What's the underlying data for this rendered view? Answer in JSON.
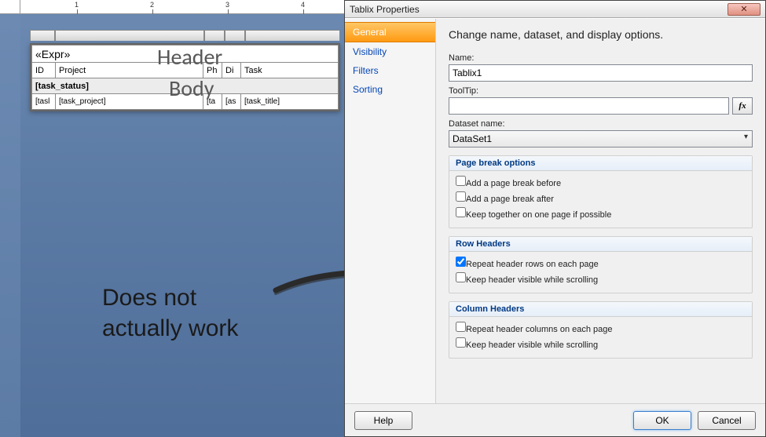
{
  "dialog": {
    "title": "Tablix Properties",
    "heading": "Change name, dataset, and display options.",
    "nav": {
      "general": "General",
      "visibility": "Visibility",
      "filters": "Filters",
      "sorting": "Sorting"
    },
    "name_label": "Name:",
    "name_value": "Tablix1",
    "tooltip_label": "ToolTip:",
    "tooltip_value": "",
    "fx": "fx",
    "dataset_label": "Dataset name:",
    "dataset_value": "DataSet1",
    "group_pb": "Page break options",
    "pb_before": "Add a page break before",
    "pb_after": "Add a page break after",
    "pb_keep": "Keep together on one page if possible",
    "group_rh": "Row Headers",
    "rh_repeat": "Repeat header rows on each page",
    "rh_scroll": "Keep header visible while scrolling",
    "group_ch": "Column Headers",
    "ch_repeat": "Repeat header columns on each page",
    "ch_scroll": "Keep header visible while scrolling",
    "help": "Help",
    "ok": "OK",
    "cancel": "Cancel",
    "close_glyph": "✕"
  },
  "tablix": {
    "expr": "«Expr»",
    "hdr_id": "ID",
    "hdr_project": "Project",
    "hdr_ph": "Ph",
    "hdr_di": "Di",
    "hdr_task": "Task",
    "status": "[task_status]",
    "b1": "[tasl",
    "b2": "[task_project]",
    "b3": "[ta",
    "b4": "[as",
    "b5": "[task_title]"
  },
  "ruler": {
    "r1": "1",
    "r2": "2",
    "r3": "3",
    "r4": "4"
  },
  "anno": {
    "header": "Header",
    "body": "Body",
    "main1": "Does not",
    "main2": "actually work"
  }
}
